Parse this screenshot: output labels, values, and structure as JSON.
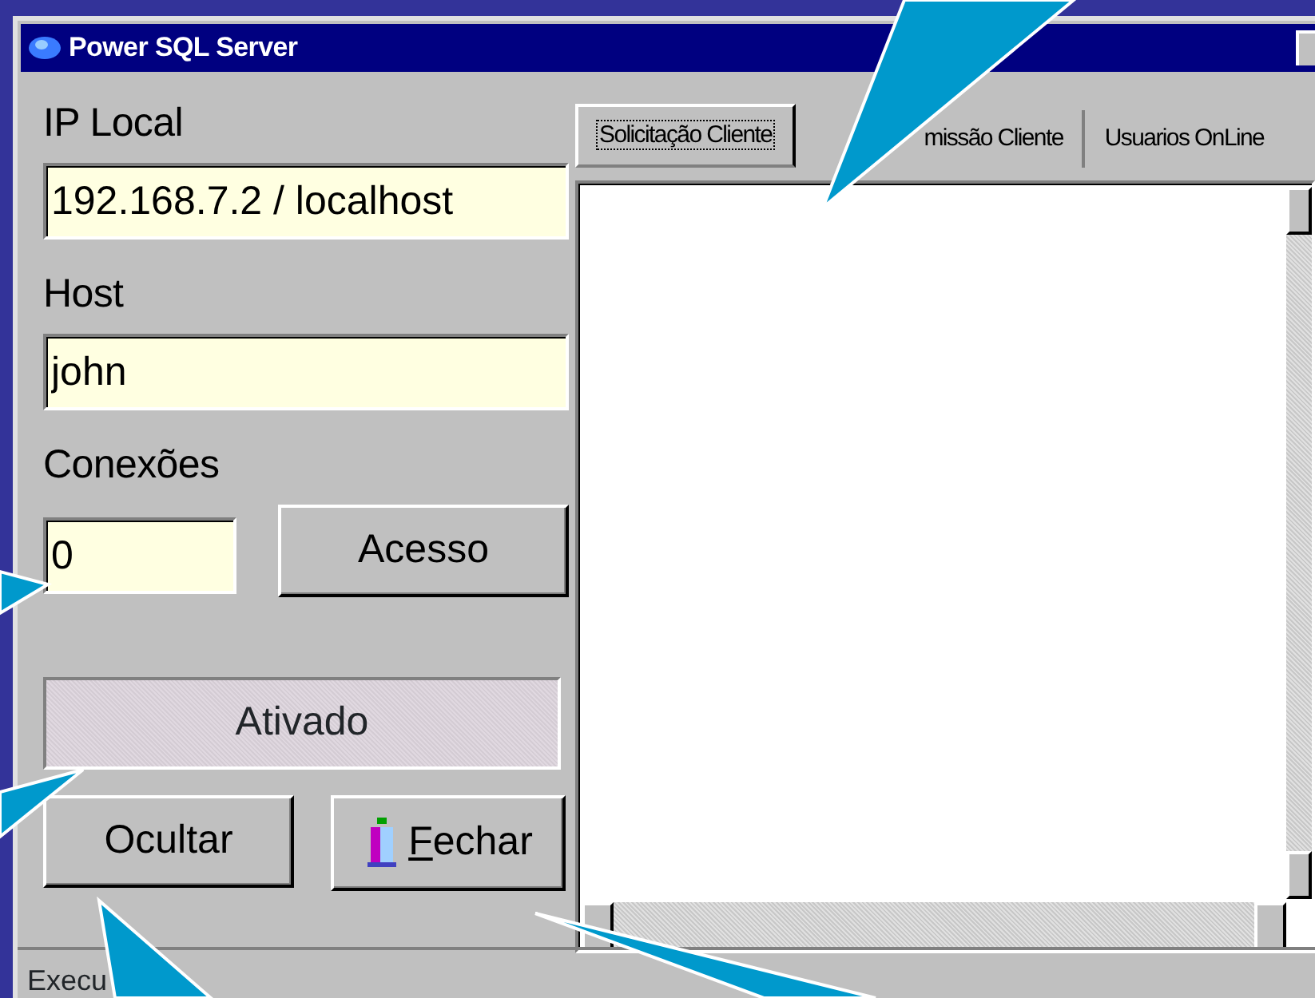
{
  "window": {
    "title": "Power SQL Server"
  },
  "fields": [
    {
      "label": "IP Local",
      "value": "192.168.7.2 / localhost"
    },
    {
      "label": "Host",
      "value": "john"
    },
    {
      "label": "Conexões",
      "value": "0"
    }
  ],
  "access_button": "Acesso",
  "status_panel": "Ativado",
  "buttons": [
    {
      "label": "Ocultar",
      "kind": "plain",
      "mnemonic_underlined": false
    },
    {
      "label": "Fechar",
      "kind": "icon",
      "mnemonic_underlined": true
    }
  ],
  "tabs": [
    {
      "label": "Solicitação Cliente",
      "selected": true
    },
    {
      "label": "missão Cliente",
      "selected": false
    },
    {
      "label": "Usuarios OnLine",
      "selected": false
    }
  ],
  "status_bar": "Execu"
}
